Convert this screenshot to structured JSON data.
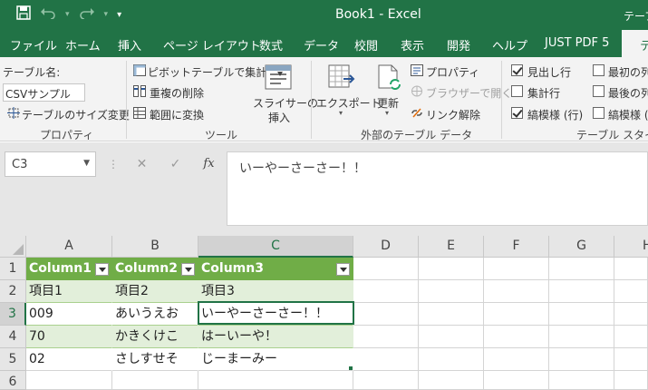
{
  "window": {
    "title": "Book1  -  Excel",
    "right_label": "テーブ"
  },
  "qat": {
    "save_icon": "save-icon",
    "undo_icon": "undo-icon",
    "redo_icon": "redo-icon",
    "customize_icon": "chevron-down-icon"
  },
  "tabs": [
    {
      "label": "ファイル"
    },
    {
      "label": "ホーム"
    },
    {
      "label": "挿入"
    },
    {
      "label": "ページ レイアウト"
    },
    {
      "label": "数式"
    },
    {
      "label": "データ"
    },
    {
      "label": "校閲"
    },
    {
      "label": "表示"
    },
    {
      "label": "開発"
    },
    {
      "label": "ヘルプ"
    },
    {
      "label": "JUST PDF 5"
    },
    {
      "label": "テ"
    }
  ],
  "ribbon": {
    "properties": {
      "table_name_label": "テーブル名:",
      "table_name_value": "CSVサンプル",
      "resize_label": "テーブルのサイズ変更",
      "group_label": "プロパティ"
    },
    "tools": {
      "pivot_label": "ピボットテーブルで集計",
      "remove_dup_label": "重複の削除",
      "convert_label": "範囲に変換",
      "slicer_label": "スライサーの挿入",
      "slicer_line1": "スライサーの",
      "slicer_line2": "挿入",
      "group_label": "ツール"
    },
    "external": {
      "export_label": "エクスポート",
      "refresh_label": "更新",
      "properties_label": "プロパティ",
      "open_browser_label": "ブラウザーで開く",
      "unlink_label": "リンク解除",
      "group_label": "外部のテーブル データ"
    },
    "style_options": {
      "header_row_label": "見出し行",
      "total_row_label": "集計行",
      "banded_rows_label": "縞模様 (行)",
      "first_column_label": "最初の列",
      "last_column_label": "最後の列",
      "banded_columns_label": "縞模様 (",
      "group_label": "テーブル スタイルの",
      "header_row_checked": true,
      "total_row_checked": false,
      "banded_rows_checked": true,
      "first_column_checked": false,
      "last_column_checked": false,
      "banded_columns_checked": false
    }
  },
  "formula_bar": {
    "name_box": "C3",
    "cancel_glyph": "✕",
    "enter_glyph": "✓",
    "fx_glyph": "fx",
    "content": "いーやーさーさー！！"
  },
  "sheet": {
    "columns": [
      "A",
      "B",
      "C",
      "D",
      "E",
      "F",
      "G",
      "H"
    ],
    "rows": [
      "1",
      "2",
      "3",
      "4",
      "5",
      "6"
    ],
    "selected_column": "C",
    "selected_row": "3",
    "table_header": [
      "Column1",
      "Column2",
      "Column3"
    ],
    "table_rows": [
      [
        "項目1",
        "項目2",
        "項目3"
      ],
      [
        "009",
        "あいうえお",
        "いーやーさーさー！！"
      ],
      [
        "70",
        "かきくけこ",
        "はーいーや！"
      ],
      [
        "02",
        "さしすせそ",
        "じーまーみー"
      ]
    ]
  },
  "colors": {
    "excel_green": "#217346",
    "table_header": "#70ad47",
    "table_band": "#e2efda"
  }
}
